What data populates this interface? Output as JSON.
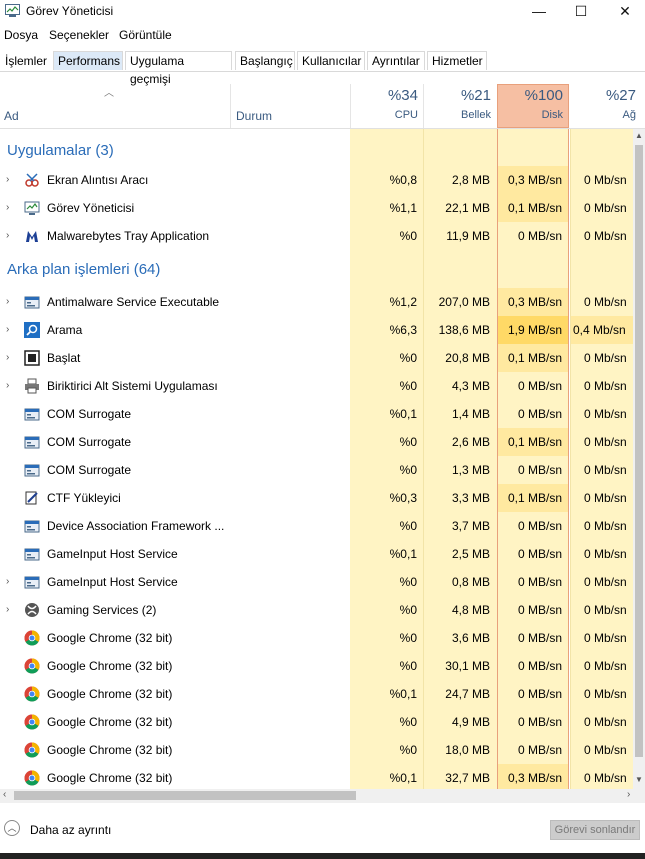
{
  "window": {
    "title": "Görev Yöneticisi",
    "minimize": "—",
    "maximize": "☐",
    "close": "✕"
  },
  "menu": [
    "Dosya",
    "Seçenekler",
    "Görüntüle"
  ],
  "tabs": [
    "İşlemler",
    "Performans",
    "Uygulama geçmişi",
    "Başlangıç",
    "Kullanıcılar",
    "Ayrıntılar",
    "Hizmetler"
  ],
  "columns": {
    "name": "Ad",
    "status": "Durum",
    "cpu_pct": "%34",
    "cpu": "CPU",
    "mem_pct": "%21",
    "mem": "Bellek",
    "disk_pct": "%100",
    "disk": "Disk",
    "net_pct": "%27",
    "net": "Ağ"
  },
  "colors": {
    "accent": "#2a6cb8",
    "heat_light": "#fff4c4",
    "heat_mid": "#ffe9a0",
    "heat_hot": "#ffd966",
    "disk_header": "#f6bfa3"
  },
  "groups": [
    {
      "title": "Uygulamalar (3)"
    },
    {
      "title": "Arka plan işlemleri (64)"
    }
  ],
  "apps": [
    {
      "name": "Ekran Alıntısı Aracı",
      "cpu": "%0,8",
      "mem": "2,8 MB",
      "disk": "0,3 MB/sn",
      "net": "0 Mb/sn",
      "expand": "›",
      "icon": "snip-icon"
    },
    {
      "name": "Görev Yöneticisi",
      "cpu": "%1,1",
      "mem": "22,1 MB",
      "disk": "0,1 MB/sn",
      "net": "0 Mb/sn",
      "expand": "›",
      "icon": "taskmgr-icon"
    },
    {
      "name": "Malwarebytes Tray Application",
      "cpu": "%0",
      "mem": "11,9 MB",
      "disk": "0 MB/sn",
      "net": "0 Mb/sn",
      "expand": "›",
      "icon": "malwarebytes-icon"
    }
  ],
  "background": [
    {
      "name": "Antimalware Service Executable",
      "cpu": "%1,2",
      "mem": "207,0 MB",
      "disk": "0,3 MB/sn",
      "net": "0 Mb/sn",
      "expand": "›",
      "icon": "service-icon"
    },
    {
      "name": "Arama",
      "cpu": "%6,3",
      "mem": "138,6 MB",
      "disk": "1,9 MB/sn",
      "net": "0,4 Mb/sn",
      "expand": "›",
      "icon": "search-icon"
    },
    {
      "name": "Başlat",
      "cpu": "%0",
      "mem": "20,8 MB",
      "disk": "0,1 MB/sn",
      "net": "0 Mb/sn",
      "expand": "›",
      "icon": "start-icon"
    },
    {
      "name": "Biriktirici Alt Sistemi Uygulaması",
      "cpu": "%0",
      "mem": "4,3 MB",
      "disk": "0 MB/sn",
      "net": "0 Mb/sn",
      "expand": "›",
      "icon": "printer-icon"
    },
    {
      "name": "COM Surrogate",
      "cpu": "%0,1",
      "mem": "1,4 MB",
      "disk": "0 MB/sn",
      "net": "0 Mb/sn",
      "expand": "",
      "icon": "service-icon"
    },
    {
      "name": "COM Surrogate",
      "cpu": "%0",
      "mem": "2,6 MB",
      "disk": "0,1 MB/sn",
      "net": "0 Mb/sn",
      "expand": "",
      "icon": "service-icon"
    },
    {
      "name": "COM Surrogate",
      "cpu": "%0",
      "mem": "1,3 MB",
      "disk": "0 MB/sn",
      "net": "0 Mb/sn",
      "expand": "",
      "icon": "service-icon"
    },
    {
      "name": "CTF Yükleyici",
      "cpu": "%0,3",
      "mem": "3,3 MB",
      "disk": "0,1 MB/sn",
      "net": "0 Mb/sn",
      "expand": "",
      "icon": "ctf-icon"
    },
    {
      "name": "Device Association Framework ...",
      "cpu": "%0",
      "mem": "3,7 MB",
      "disk": "0 MB/sn",
      "net": "0 Mb/sn",
      "expand": "",
      "icon": "service-icon"
    },
    {
      "name": "GameInput Host Service",
      "cpu": "%0,1",
      "mem": "2,5 MB",
      "disk": "0 MB/sn",
      "net": "0 Mb/sn",
      "expand": "",
      "icon": "service-icon"
    },
    {
      "name": "GameInput Host Service",
      "cpu": "%0",
      "mem": "0,8 MB",
      "disk": "0 MB/sn",
      "net": "0 Mb/sn",
      "expand": "›",
      "icon": "service-icon"
    },
    {
      "name": "Gaming Services (2)",
      "cpu": "%0",
      "mem": "4,8 MB",
      "disk": "0 MB/sn",
      "net": "0 Mb/sn",
      "expand": "›",
      "icon": "xbox-icon"
    },
    {
      "name": "Google Chrome (32 bit)",
      "cpu": "%0",
      "mem": "3,6 MB",
      "disk": "0 MB/sn",
      "net": "0 Mb/sn",
      "expand": "",
      "icon": "chrome-icon"
    },
    {
      "name": "Google Chrome (32 bit)",
      "cpu": "%0",
      "mem": "30,1 MB",
      "disk": "0 MB/sn",
      "net": "0 Mb/sn",
      "expand": "",
      "icon": "chrome-icon"
    },
    {
      "name": "Google Chrome (32 bit)",
      "cpu": "%0,1",
      "mem": "24,7 MB",
      "disk": "0 MB/sn",
      "net": "0 Mb/sn",
      "expand": "",
      "icon": "chrome-icon"
    },
    {
      "name": "Google Chrome (32 bit)",
      "cpu": "%0",
      "mem": "4,9 MB",
      "disk": "0 MB/sn",
      "net": "0 Mb/sn",
      "expand": "",
      "icon": "chrome-icon"
    },
    {
      "name": "Google Chrome (32 bit)",
      "cpu": "%0",
      "mem": "18,0 MB",
      "disk": "0 MB/sn",
      "net": "0 Mb/sn",
      "expand": "",
      "icon": "chrome-icon"
    },
    {
      "name": "Google Chrome (32 bit)",
      "cpu": "%0,1",
      "mem": "32,7 MB",
      "disk": "0,3 MB/sn",
      "net": "0 Mb/sn",
      "expand": "",
      "icon": "chrome-icon"
    }
  ],
  "footer": {
    "fewer_details": "Daha az ayrıntı",
    "end_task": "Görevi sonlandır"
  }
}
